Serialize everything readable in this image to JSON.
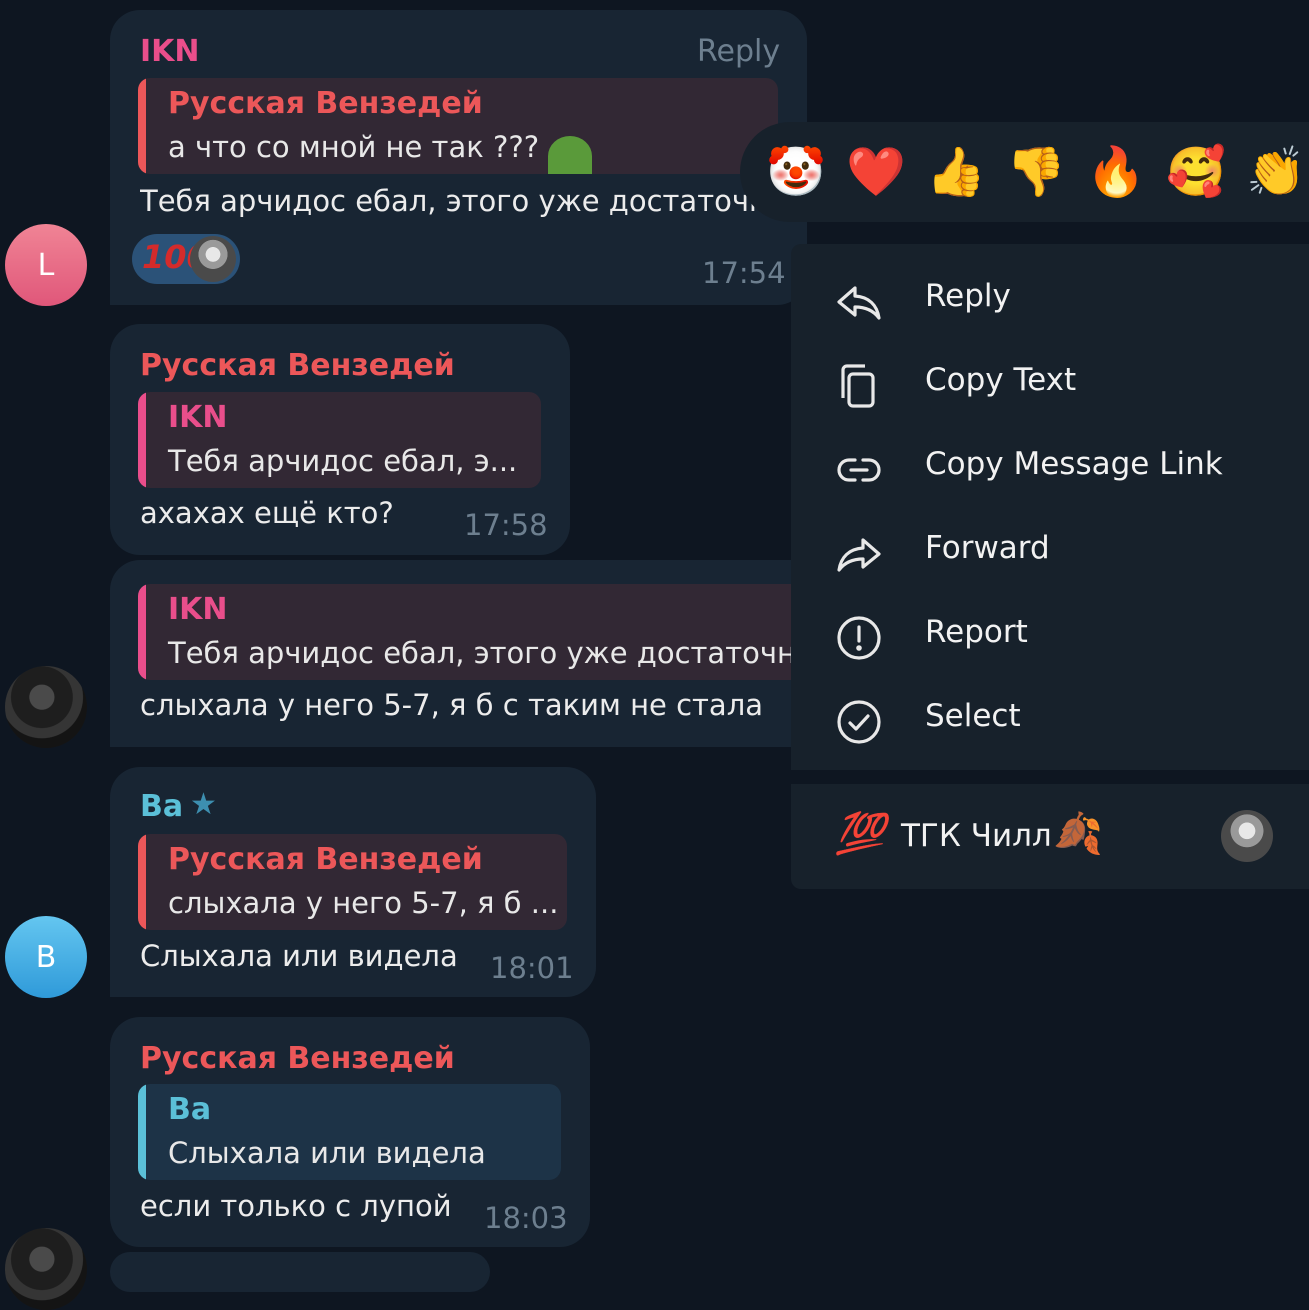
{
  "colors": {
    "background": "#0e1621",
    "bubble": "#182533",
    "menu": "#17212b",
    "name_ikn": "#e94e8b",
    "name_vendei": "#ec5759",
    "name_ba": "#5bc0d8",
    "quote_bg_red": "#322834",
    "quote_bg_blue": "#1d3347",
    "meta": "#6d7f8f"
  },
  "messages": [
    {
      "avatar_letter": "L",
      "sender": "IKN",
      "reply_hint": "Reply",
      "quote_name": "Русская Вензедей",
      "quote_text": "а что со мной не так ???",
      "text": "Тебя арчидос ебал, этого уже достаточно",
      "reaction_icon": "100-emoji",
      "time": "17:54"
    },
    {
      "sender": "Русская Вензедей",
      "quote_name": "IKN",
      "quote_text": "Тебя арчидос ебал, э...",
      "text": "ахахах ещё кто?",
      "time": "17:58"
    },
    {
      "quote_name": "IKN",
      "quote_text": "Тебя арчидос ебал, этого уже достаточно",
      "text": "слыхала у него 5-7, я б с таким не стала"
    },
    {
      "avatar_letter": "B",
      "sender": "Ba",
      "sender_badge_icon": "star-icon",
      "quote_name": "Русская Вензедей",
      "quote_text": "слыхала у него 5-7, я б ...",
      "text": "Слыхала или видела",
      "time": "18:01"
    },
    {
      "sender": "Русская Вензедей",
      "quote_name": "Ba",
      "quote_text": "Слыхала или видела",
      "text": "если только с лупой",
      "time": "18:03"
    }
  ],
  "reactions": [
    {
      "name": "clown-emoji",
      "glyph": "🤡"
    },
    {
      "name": "heart-emoji",
      "glyph": "❤️"
    },
    {
      "name": "thumbs-up-emoji",
      "glyph": "👍"
    },
    {
      "name": "thumbs-down-emoji",
      "glyph": "👎"
    },
    {
      "name": "fire-emoji",
      "glyph": "🔥"
    },
    {
      "name": "smiling-hearts-emoji",
      "glyph": "🥰"
    },
    {
      "name": "clapping-emoji",
      "glyph": "👏"
    }
  ],
  "context_menu": {
    "items": [
      {
        "label": "Reply",
        "icon": "reply-icon"
      },
      {
        "label": "Copy Text",
        "icon": "copy-icon"
      },
      {
        "label": "Copy Message Link",
        "icon": "link-icon"
      },
      {
        "label": "Forward",
        "icon": "forward-icon"
      },
      {
        "label": "Report",
        "icon": "report-icon"
      },
      {
        "label": "Select",
        "icon": "check-circle-icon"
      }
    ],
    "reacted": {
      "emoji_glyph": "💯",
      "label": "ТГК Чилл",
      "leaf_glyph": "🍂"
    }
  }
}
